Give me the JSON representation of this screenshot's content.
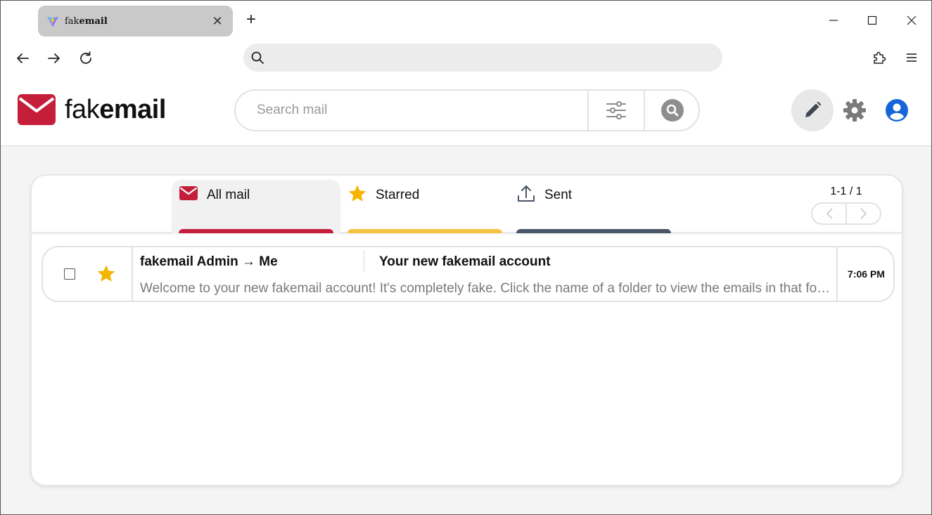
{
  "browser": {
    "tab": {
      "title_light": "fak",
      "title_bold": "email",
      "close_label": "✕"
    },
    "new_tab_label": "+",
    "address": {
      "value": "",
      "placeholder": ""
    }
  },
  "app": {
    "logo": {
      "light": "fak",
      "bold": "email"
    },
    "search": {
      "placeholder": "Search mail",
      "value": ""
    },
    "colors": {
      "brand_red": "#c41e3a",
      "star_yellow": "#f5b400",
      "sent_slate": "#4a5568",
      "account_blue": "#1565d8"
    }
  },
  "folders": [
    {
      "label": "All mail",
      "icon": "envelope-icon",
      "color": "#c41e3a",
      "active": true
    },
    {
      "label": "Starred",
      "icon": "star-icon",
      "color": "#f5c242",
      "active": false
    },
    {
      "label": "Sent",
      "icon": "upload-icon",
      "color": "#4a5568",
      "active": false
    }
  ],
  "pager": {
    "count": "1-1 / 1"
  },
  "emails": [
    {
      "from": "fakemail Admin → Me",
      "subject": "Your new fakemail account",
      "preview": "Welcome to your new fakemail account! It's completely fake. Click the name of a folder to view the emails in that folder.",
      "time": "7:06 PM",
      "starred": true,
      "checked": false
    }
  ]
}
